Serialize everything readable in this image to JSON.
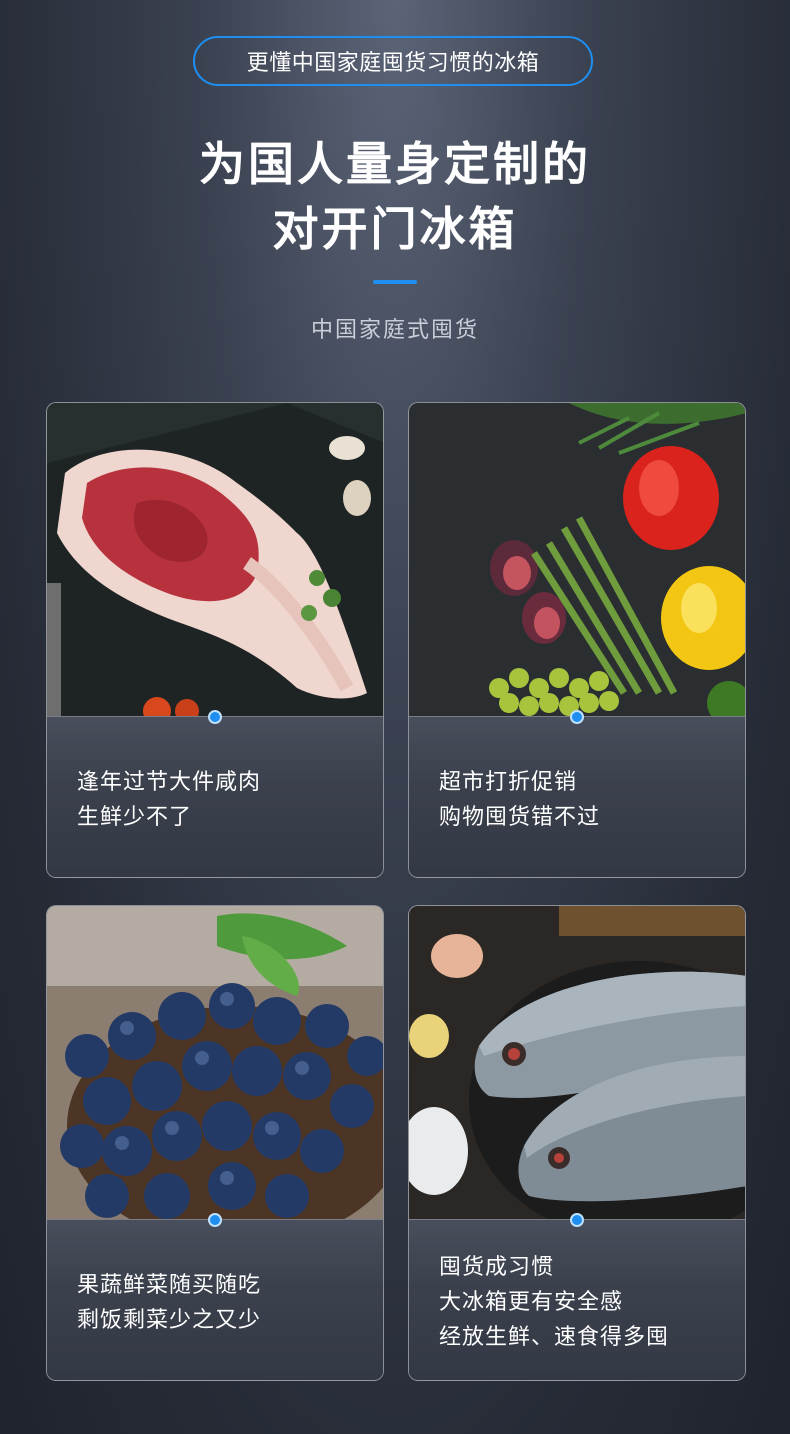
{
  "header": {
    "tagline": "更懂中国家庭囤货习惯的冰箱",
    "title_line1": "为国人量身定制的",
    "title_line2": "对开门冰箱",
    "subtitle": "中国家庭式囤货"
  },
  "colors": {
    "accent": "#1e8ff0",
    "background": "#2a2f3a"
  },
  "cards": [
    {
      "image": "ribeye-steak-photo",
      "lines": [
        "逢年过节大件咸肉",
        "生鲜少不了"
      ]
    },
    {
      "image": "vegetables-fruits-photo",
      "lines": [
        "超市打折促销",
        "购物囤货错不过"
      ]
    },
    {
      "image": "blueberries-photo",
      "lines": [
        "果蔬鲜菜随买随吃",
        "剩饭剩菜少之又少"
      ]
    },
    {
      "image": "fresh-fish-photo",
      "lines": [
        "囤货成习惯",
        "大冰箱更有安全感",
        "经放生鲜、速食得多囤"
      ]
    }
  ]
}
